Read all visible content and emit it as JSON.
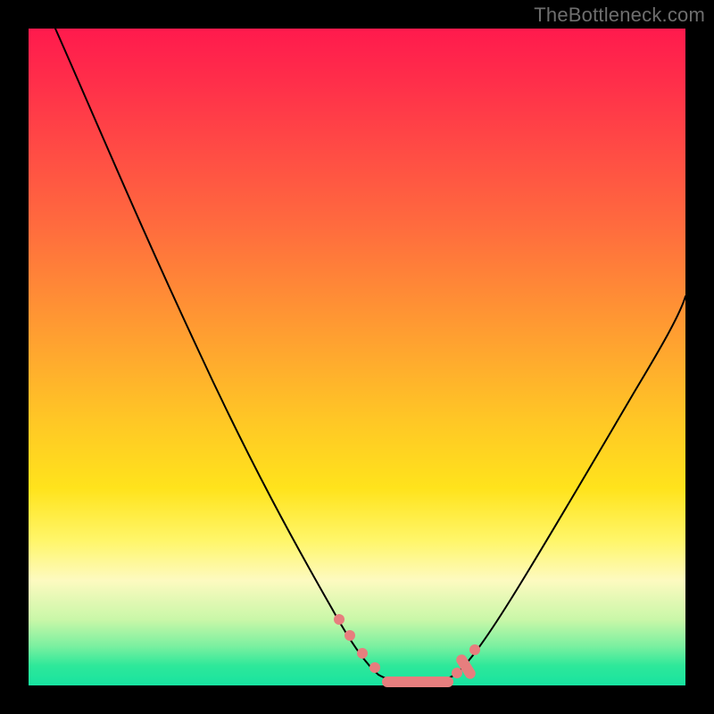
{
  "watermark": "TheBottleneck.com",
  "colors": {
    "frame": "#000000",
    "gradient_top": "#ff1a4d",
    "gradient_bottom": "#18e3a0",
    "curve": "#000000",
    "marker": "#e77e7e"
  },
  "chart_data": {
    "type": "line",
    "title": "",
    "xlabel": "",
    "ylabel": "",
    "xlim": [
      0,
      100
    ],
    "ylim": [
      0,
      100
    ],
    "series": [
      {
        "name": "left-curve",
        "x": [
          4,
          10,
          16,
          22,
          28,
          34,
          40,
          45,
          48,
          50,
          52,
          54
        ],
        "y": [
          100,
          90,
          79,
          67,
          55,
          42,
          29,
          17,
          9,
          4,
          1.5,
          0.6
        ]
      },
      {
        "name": "basin",
        "x": [
          54,
          56,
          58,
          60,
          62,
          64
        ],
        "y": [
          0.6,
          0.3,
          0.2,
          0.2,
          0.3,
          0.6
        ]
      },
      {
        "name": "right-curve",
        "x": [
          64,
          66,
          70,
          76,
          82,
          88,
          94,
          100
        ],
        "y": [
          0.6,
          2,
          7,
          17,
          28,
          39,
          50,
          60
        ]
      }
    ],
    "markers": {
      "name": "highlight-points",
      "x": [
        47,
        49,
        51,
        53,
        55,
        58,
        61,
        64,
        65.5,
        67
      ],
      "y": [
        10,
        6.5,
        3.8,
        2.0,
        1.0,
        0.4,
        0.4,
        1.0,
        2.2,
        4.2
      ]
    },
    "annotations": []
  }
}
